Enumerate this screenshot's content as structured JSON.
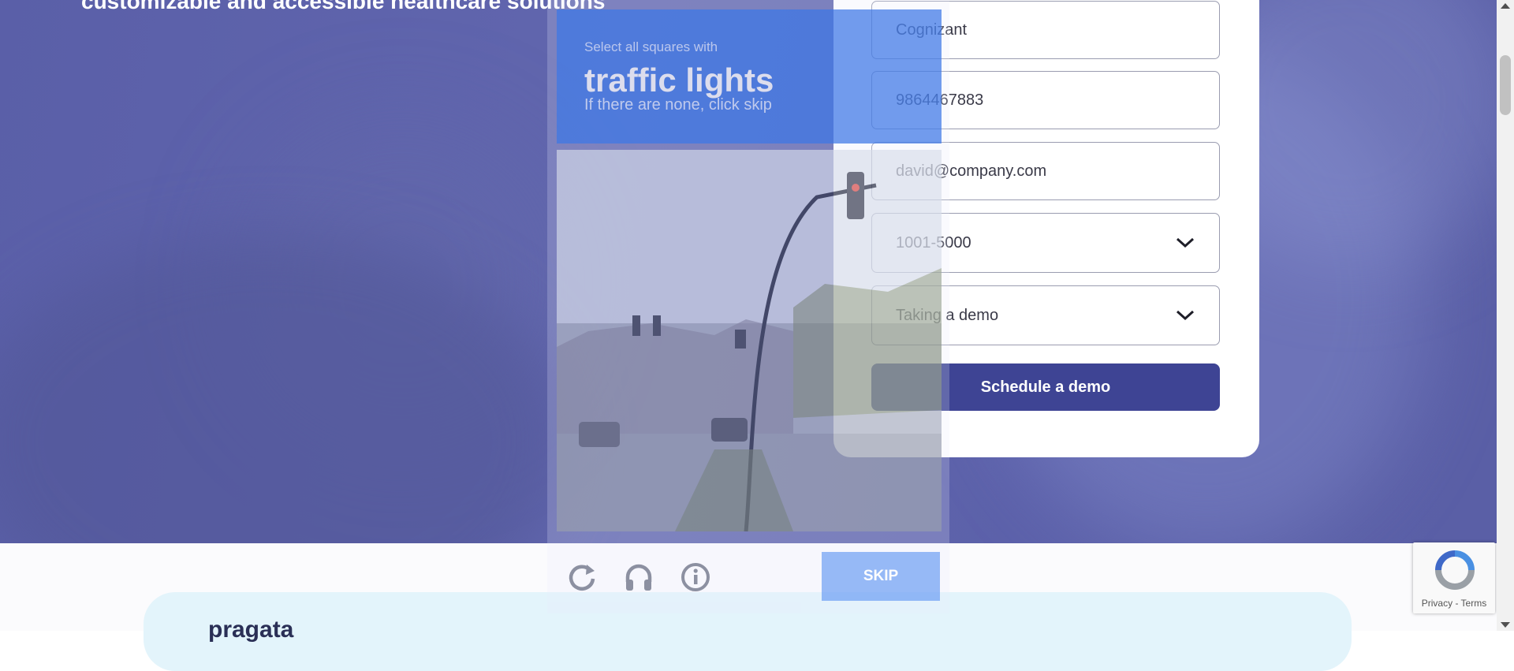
{
  "hero": {
    "headline": "customizable and accessible healthcare solutions"
  },
  "form": {
    "company_value": "Cognizant",
    "phone_value": "9864467883",
    "email_value": "david@company.com",
    "company_size_value": "1001-5000",
    "interest_value": "Taking a demo",
    "submit_label": "Schedule a demo"
  },
  "captcha": {
    "instruction": "Select all squares with",
    "target": "traffic lights",
    "hint": "If there are none, click skip",
    "skip_label": "SKIP",
    "icons": [
      "reload-icon",
      "headphones-icon",
      "info-icon"
    ]
  },
  "lower": {
    "card_heading": "pragata"
  },
  "recaptcha_badge": {
    "links": "Privacy - Terms"
  },
  "colors": {
    "hero_overlay": "#5a5fa8",
    "cta": "#3e4494",
    "captcha_header": "#4a80e8",
    "skip": "#7aa7f5"
  }
}
